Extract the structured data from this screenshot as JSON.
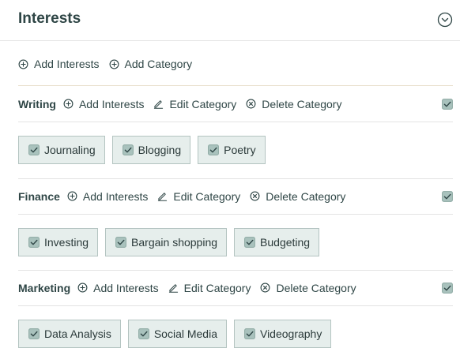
{
  "header": {
    "title": "Interests"
  },
  "top_actions": {
    "add_interests": "Add Interests",
    "add_category": "Add Category"
  },
  "category_actions": {
    "add_interests": "Add Interests",
    "edit_category": "Edit Category",
    "delete_category": "Delete Category"
  },
  "categories": [
    {
      "name": "Writing",
      "checked": true,
      "interests": [
        {
          "label": "Journaling",
          "checked": true
        },
        {
          "label": "Blogging",
          "checked": true
        },
        {
          "label": "Poetry",
          "checked": true
        }
      ]
    },
    {
      "name": "Finance",
      "checked": true,
      "interests": [
        {
          "label": "Investing",
          "checked": true
        },
        {
          "label": "Bargain shopping",
          "checked": true
        },
        {
          "label": "Budgeting",
          "checked": true
        }
      ]
    },
    {
      "name": "Marketing",
      "checked": true,
      "interests": [
        {
          "label": "Data Analysis",
          "checked": true
        },
        {
          "label": "Social Media",
          "checked": true
        },
        {
          "label": "Videography",
          "checked": true
        }
      ]
    }
  ],
  "colors": {
    "text": "#2f4646",
    "chip_bg": "#e6eeec",
    "chip_border": "#b4c4c1",
    "check_fill": "#a9c2bd",
    "accent_line": "#e8dfcc"
  },
  "icons": {
    "collapse": "chevron-down-circle-icon",
    "add": "plus-circle-icon",
    "edit": "pencil-icon",
    "delete": "x-circle-icon",
    "checkbox": "checkbox-checked-icon"
  }
}
